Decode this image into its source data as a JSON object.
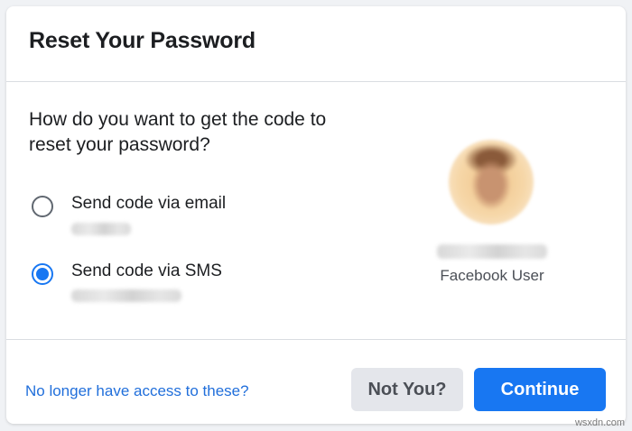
{
  "dialog": {
    "title": "Reset Your Password",
    "question": "How do you want to get the code to reset your password?"
  },
  "options": [
    {
      "label": "Send code via email",
      "selected": false
    },
    {
      "label": "Send code via SMS",
      "selected": true
    }
  ],
  "user": {
    "caption": "Facebook User"
  },
  "footer": {
    "no_access_link": "No longer have access to these?",
    "not_you_label": "Not You?",
    "continue_label": "Continue"
  },
  "watermark": "wsxdn.com",
  "colors": {
    "primary": "#1877f2",
    "link": "#216fdb",
    "secondary_button": "#e4e6eb",
    "text": "#1c1e21",
    "page_background": "#f0f2f5"
  }
}
